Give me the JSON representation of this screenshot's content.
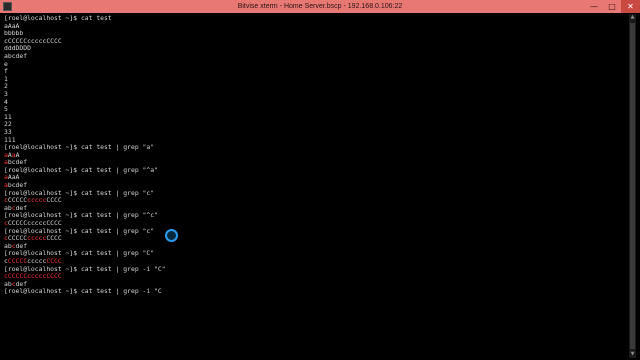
{
  "window": {
    "title": "Bitvise xterm - Home Server.bscp - 192.168.0.106:22",
    "buttons": {
      "minimize": "—",
      "maximize": "□",
      "close": "✕"
    }
  },
  "terminal": {
    "lines": [
      [
        {
          "t": "[roel@localhost ~]$ cat test"
        }
      ],
      [
        {
          "t": "aAaA"
        }
      ],
      [
        {
          "t": "bbbbb"
        }
      ],
      [
        {
          "t": "cCCCCCcccccCCCC"
        }
      ],
      [
        {
          "t": "dddDDDD"
        }
      ],
      [
        {
          "t": "abcdef"
        }
      ],
      [
        {
          "t": "e"
        }
      ],
      [
        {
          "t": "f"
        }
      ],
      [
        {
          "t": "1"
        }
      ],
      [
        {
          "t": "2"
        }
      ],
      [
        {
          "t": "3"
        }
      ],
      [
        {
          "t": "4"
        }
      ],
      [
        {
          "t": "5"
        }
      ],
      [
        {
          "t": "11"
        }
      ],
      [
        {
          "t": "22"
        }
      ],
      [
        {
          "t": "33"
        }
      ],
      [
        {
          "t": "111"
        }
      ],
      [
        {
          "t": "[roel@localhost ~]$ cat test | grep \"a\""
        }
      ],
      [
        {
          "t": "a",
          "h": 1
        },
        {
          "t": "A"
        },
        {
          "t": "a",
          "h": 1
        },
        {
          "t": "A"
        }
      ],
      [
        {
          "t": "a",
          "h": 1
        },
        {
          "t": "bcdef"
        }
      ],
      [
        {
          "t": "[roel@localhost ~]$ cat test | grep \"^a\""
        }
      ],
      [
        {
          "t": "a",
          "h": 1
        },
        {
          "t": "AaA"
        }
      ],
      [
        {
          "t": "a",
          "h": 1
        },
        {
          "t": "bcdef"
        }
      ],
      [
        {
          "t": "[roel@localhost ~]$ cat test | grep \"c\""
        }
      ],
      [
        {
          "t": "c",
          "h": 1
        },
        {
          "t": "CCCCC"
        },
        {
          "t": "ccccc",
          "h": 1
        },
        {
          "t": "CCCC"
        }
      ],
      [
        {
          "t": "ab"
        },
        {
          "t": "c",
          "h": 1
        },
        {
          "t": "def"
        }
      ],
      [
        {
          "t": "[roel@localhost ~]$ cat test | grep \"^c\""
        }
      ],
      [
        {
          "t": "c",
          "h": 1
        },
        {
          "t": "CCCCCcccccCCCC"
        }
      ],
      [
        {
          "t": "[roel@localhost ~]$ cat test | grep \"c\""
        }
      ],
      [
        {
          "t": "c",
          "h": 1
        },
        {
          "t": "CCCCC"
        },
        {
          "t": "ccccc",
          "h": 1
        },
        {
          "t": "CCCC"
        }
      ],
      [
        {
          "t": "ab"
        },
        {
          "t": "c",
          "h": 1
        },
        {
          "t": "def"
        }
      ],
      [
        {
          "t": "[roel@localhost ~]$ cat test | grep \"C\""
        }
      ],
      [
        {
          "t": "c"
        },
        {
          "t": "CCCCC",
          "h": 1
        },
        {
          "t": "ccccc"
        },
        {
          "t": "CCCC",
          "h": 1
        }
      ],
      [
        {
          "t": "[roel@localhost ~]$ cat test | grep -i \"C\""
        }
      ],
      [
        {
          "t": "cCCCCCcccccCCCC",
          "h": 1
        }
      ],
      [
        {
          "t": "ab"
        },
        {
          "t": "c",
          "h": 1
        },
        {
          "t": "def"
        }
      ],
      [
        {
          "t": "[roel@localhost ~]$ cat test | grep -i \"C"
        }
      ]
    ]
  },
  "scrollbar": {
    "up": "▲",
    "down": "▼"
  },
  "colors": {
    "text": "#d8d8d8",
    "match": "#ff3333",
    "titlebar": "#e87873",
    "background": "#000000"
  }
}
